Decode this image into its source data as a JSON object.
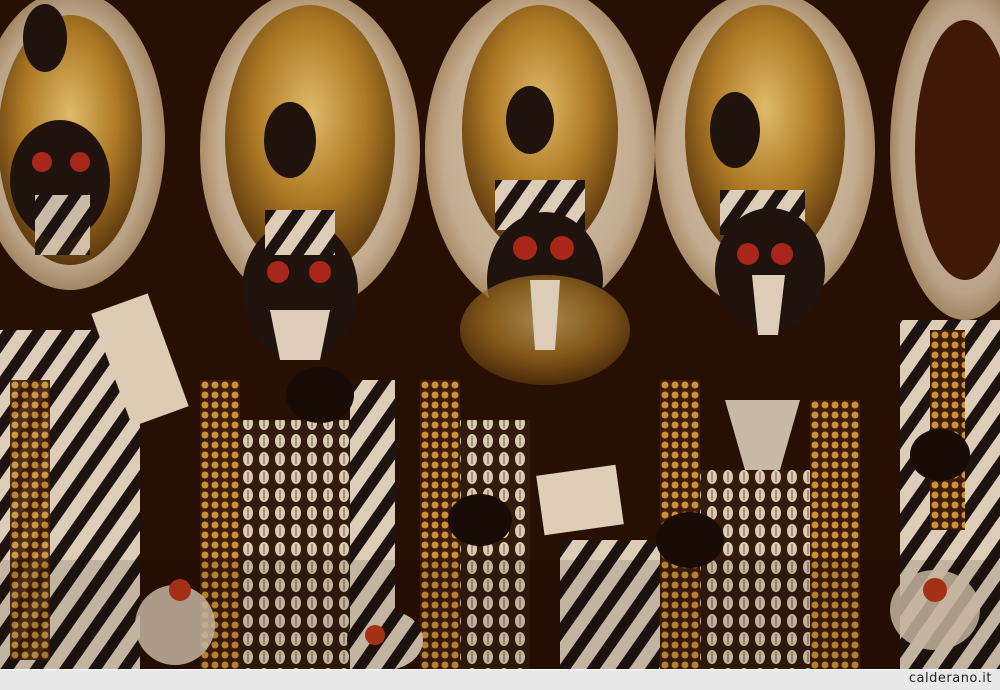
{
  "photo": {
    "subject": "rows-of-masked-dancers-in-ornate-feathered-costumes",
    "palette": {
      "background": "#2a1006",
      "gold": "#c9a03a",
      "feather": "#f2ead8",
      "mask": "#141010",
      "red": "#b3261e",
      "zebra_dark": "#111111",
      "zebra_light": "#efe7d6"
    }
  },
  "footer": {
    "credit": "calderano.it"
  }
}
